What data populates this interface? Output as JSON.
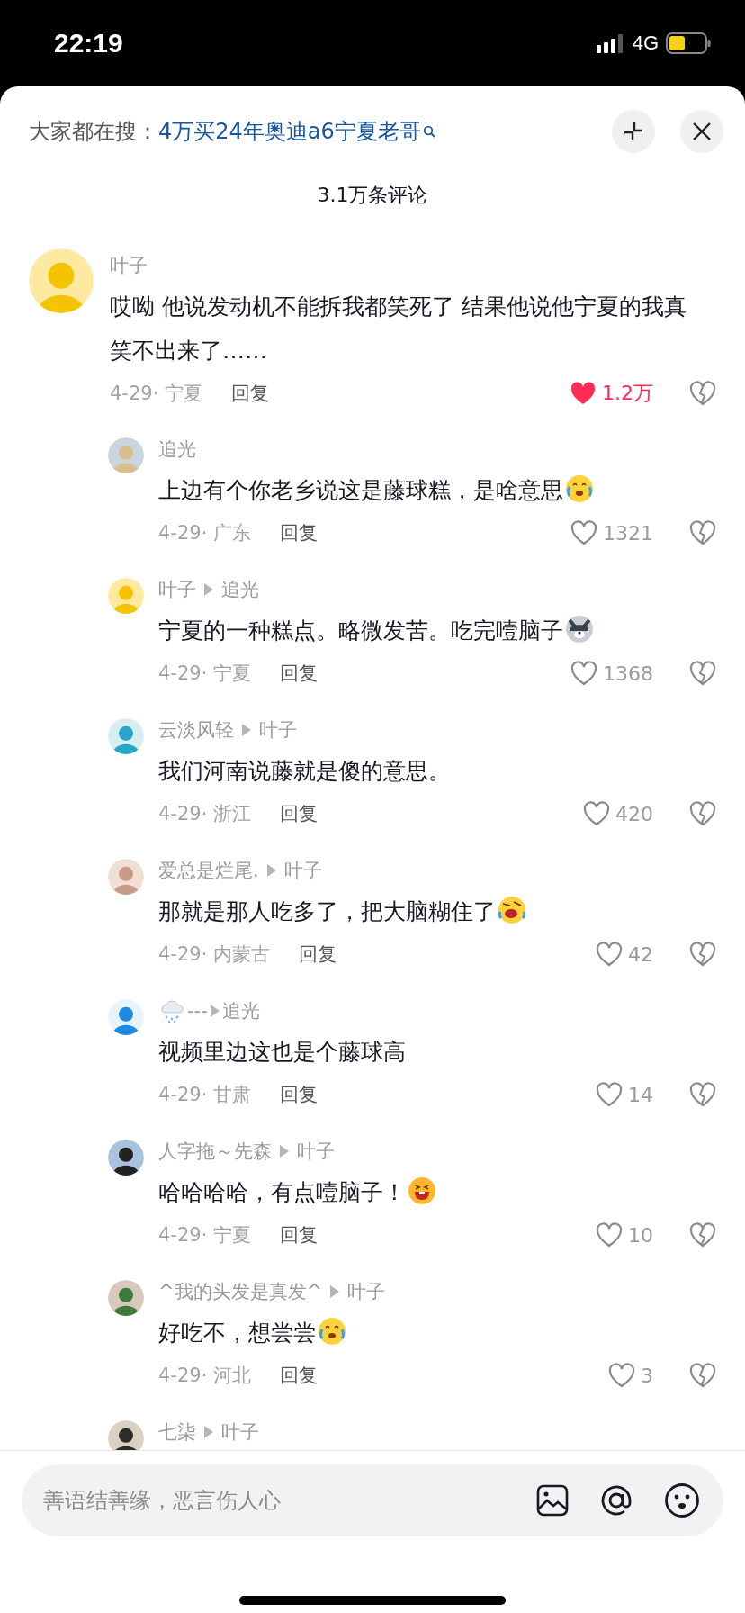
{
  "status_bar": {
    "time": "22:19",
    "network": "4G"
  },
  "header": {
    "label": "大家都在搜：",
    "query": "4万买24年奥迪a6宁夏老哥"
  },
  "comment_count": "3.1万条评论",
  "comments": [
    {
      "author": "叶子",
      "text": "哎呦 他说发动机不能拆我都笑死了 结果他说他宁夏的我真笑不出来了……",
      "meta": "4-29· 宁夏",
      "reply": "回复",
      "likes": "1.2万",
      "liked": true,
      "replies": [
        {
          "author": "追光",
          "text": "上边有个你老乡说这是藤球糕，是啥意思",
          "emoji": {
            "kind": "tears"
          },
          "meta": "4-29· 广东",
          "reply": "回复",
          "likes": "1321",
          "liked": false
        },
        {
          "author": "叶子",
          "reply_to": "追光",
          "text": "宁夏的一种糕点。略微发苦。吃完噎脑子",
          "emoji": {
            "kind": "dog"
          },
          "meta": "4-29· 宁夏",
          "reply": "回复",
          "likes": "1368",
          "liked": false
        },
        {
          "author": "云淡风轻",
          "reply_to": "叶子",
          "text": "我们河南说藤就是傻的意思。",
          "meta": "4-29· 浙江",
          "reply": "回复",
          "likes": "420",
          "liked": false
        },
        {
          "author": "爱总是烂尾.",
          "reply_to": "叶子",
          "text": "那就是那人吃多了，把大脑糊住了",
          "emoji": {
            "kind": "rofl"
          },
          "meta": "4-29· 内蒙古",
          "reply": "回复",
          "likes": "42",
          "liked": false
        },
        {
          "author": "---",
          "name_icon": true,
          "reply_to": "追光",
          "text": "视频里边这也是个藤球高",
          "meta": "4-29· 甘肃",
          "reply": "回复",
          "likes": "14",
          "liked": false
        },
        {
          "author": "人字拖～先森",
          "reply_to": "叶子",
          "text": "哈哈哈哈，有点噎脑子！",
          "emoji": {
            "kind": "grin"
          },
          "meta": "4-29· 宁夏",
          "reply": "回复",
          "likes": "10",
          "liked": false
        },
        {
          "author": "^我的头发是真发^",
          "reply_to": "叶子",
          "text": "好吃不，想尝尝",
          "emoji": {
            "kind": "tears"
          },
          "meta": "4-29· 河北",
          "reply": "回复",
          "likes": "3",
          "liked": false
        },
        {
          "author": "七柒",
          "reply_to": "叶子"
        }
      ]
    }
  ],
  "input": {
    "placeholder": "善语结善缘，恶言伤人心"
  }
}
